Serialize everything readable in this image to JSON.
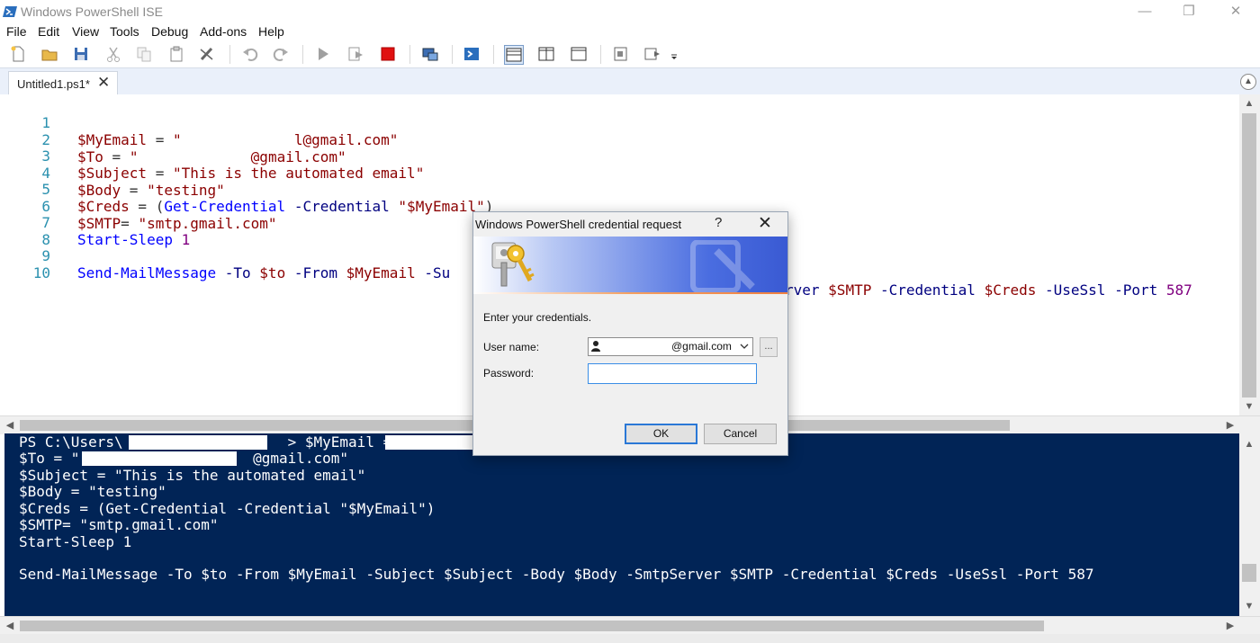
{
  "window": {
    "title": "Windows PowerShell ISE",
    "minimize": "—",
    "restore": "❐",
    "close": "✕"
  },
  "menu": [
    "File",
    "Edit",
    "View",
    "Tools",
    "Debug",
    "Add-ons",
    "Help"
  ],
  "toolbar_icons": [
    "new-file-icon",
    "open-file-icon",
    "save-icon",
    "cut-icon",
    "copy-icon",
    "paste-icon",
    "clear-icon",
    "undo-icon",
    "redo-icon",
    "run-script-icon",
    "run-selection-icon",
    "stop-icon",
    "remote-powershell-icon",
    "powershell-icon",
    "show-script-pane-top-icon",
    "show-script-pane-right-icon",
    "show-script-pane-maximized-icon",
    "show-command-window-icon",
    "show-command-addon-icon"
  ],
  "tab": {
    "label": "Untitled1.ps1*",
    "close": "✕"
  },
  "editor": {
    "line_numbers": [
      "1",
      "2",
      "3",
      "4",
      "5",
      "6",
      "7",
      "8",
      "9",
      "10"
    ],
    "lines": {
      "l1": {
        "var": "$MyEmail",
        "op": " = ",
        "str": "\"             l@gmail.com\""
      },
      "l2": {
        "var": "$To",
        "op": " = ",
        "str": "\"             @gmail.com\""
      },
      "l3": {
        "var": "$Subject",
        "op": " = ",
        "str": "\"This is the automated email\""
      },
      "l4": {
        "var": "$Body",
        "op": " = ",
        "str": "\"testing\""
      },
      "l5": {
        "var": "$Creds",
        "op": " = (",
        "cmd": "Get-Credential",
        "param": " -Credential ",
        "str": "\"$MyEmail\"",
        "close": ")"
      },
      "l6": {
        "var": "$SMTP",
        "op": "= ",
        "str": "\"smtp.gmail.com\""
      },
      "l7": {
        "cmd": "Start-Sleep",
        "num": " 1"
      },
      "l9": {
        "cmd": "Send-MailMessage",
        "p1": " -To ",
        "v1": "$to",
        "p2": " -From ",
        "v2": "$MyEmail",
        "p3": " -Su",
        "p4": "rver ",
        "v4": "$SMTP",
        "p5": " -Credential ",
        "v5": "$Creds",
        "p6": " -UseSsl -Port ",
        "n6": "587"
      }
    }
  },
  "console": {
    "lines": [
      "PS C:\\Users\\                   > $MyEmail = ",
      "$To = \"                    @gmail.com\"",
      "$Subject = \"This is the automated email\"",
      "$Body = \"testing\"",
      "$Creds = (Get-Credential -Credential \"$MyEmail\")",
      "$SMTP= \"smtp.gmail.com\"",
      "Start-Sleep 1",
      "",
      "Send-MailMessage -To $to -From $MyEmail -Subject $Subject -Body $Body -SmtpServer $SMTP -Credential $Creds -UseSsl -Port 587"
    ]
  },
  "dialog": {
    "title": "Windows PowerShell credential request",
    "help": "?",
    "close": "✕",
    "prompt": "Enter your credentials.",
    "username_label": "User name:",
    "username_value": "@gmail.com",
    "browse_label": "...",
    "password_label": "Password:",
    "password_value": "",
    "ok_label": "OK",
    "cancel_label": "Cancel"
  },
  "colors": {
    "console_bg": "#012456",
    "line_number": "#2b91af",
    "variable": "#8b0000",
    "string": "#8b0000",
    "command": "#0000ff",
    "parameter": "#000080",
    "number": "#800080"
  }
}
